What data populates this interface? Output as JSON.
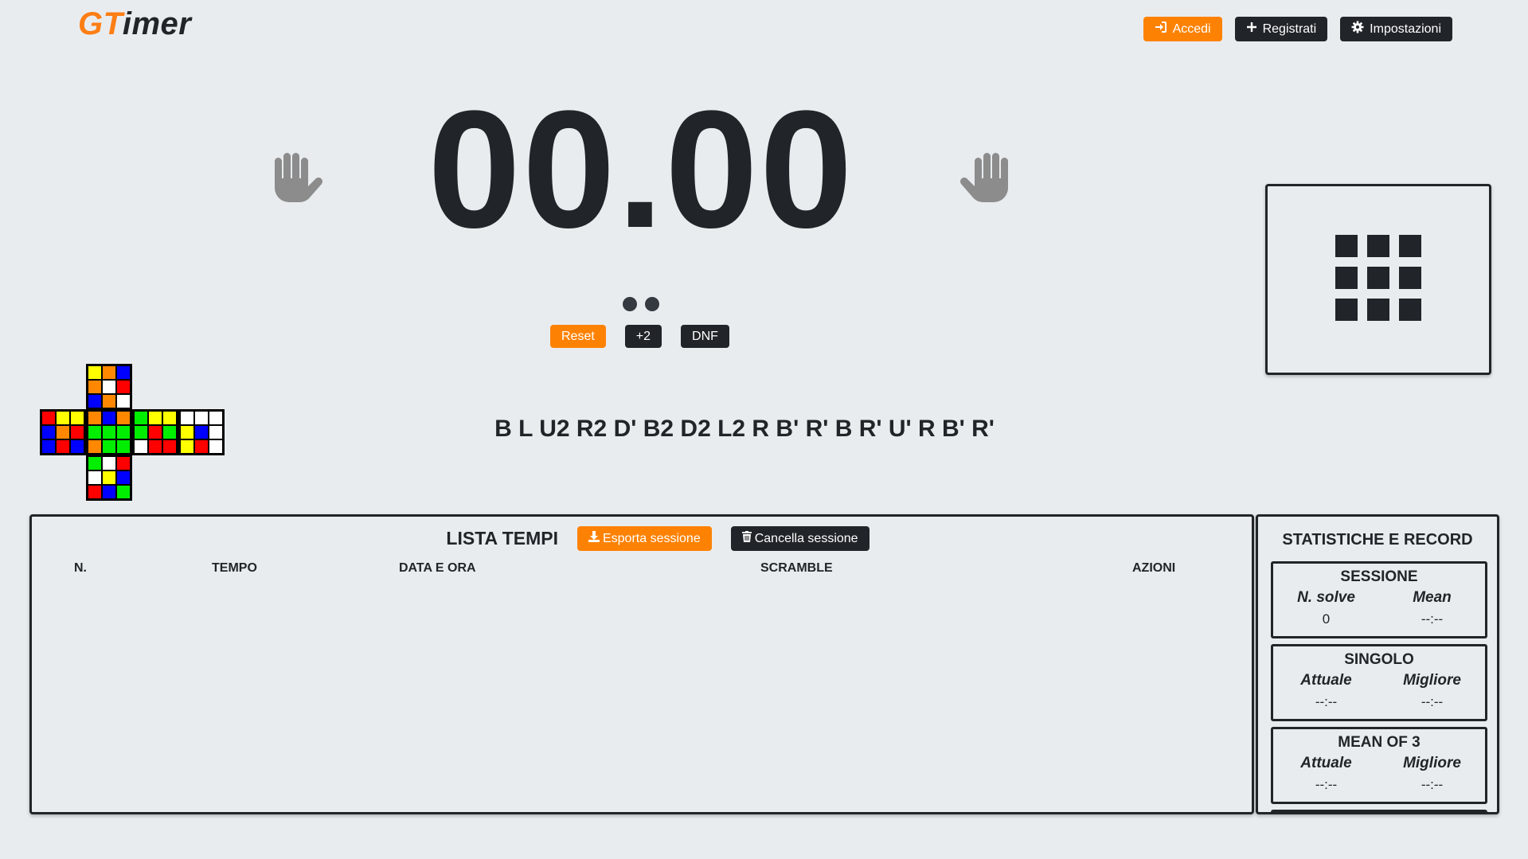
{
  "logo": {
    "part1": "GT",
    "part2": "imer"
  },
  "nav": {
    "login": "Accedi",
    "register": "Registrati",
    "settings": "Impostazioni"
  },
  "timer": {
    "display": "00.00"
  },
  "actions": {
    "reset": "Reset",
    "plus2": "+2",
    "dnf": "DNF"
  },
  "scramble": "B L U2 R2 D' B2 D2 L2 R B' R' B R' U' R B' R'",
  "cube": {
    "colors": {
      "Y": "#ffff00",
      "O": "#ff8800",
      "B": "#0000ff",
      "W": "#ffffff",
      "R": "#ff0000",
      "G": "#00ee00"
    },
    "up": [
      "Y",
      "O",
      "B",
      "O",
      "W",
      "R",
      "B",
      "O",
      "W"
    ],
    "left": [
      "R",
      "Y",
      "Y",
      "B",
      "O",
      "R",
      "B",
      "R",
      "B"
    ],
    "front": [
      "O",
      "B",
      "O",
      "G",
      "G",
      "G",
      "O",
      "G",
      "G"
    ],
    "right": [
      "G",
      "Y",
      "Y",
      "G",
      "R",
      "G",
      "W",
      "R",
      "R"
    ],
    "back": [
      "W",
      "W",
      "W",
      "Y",
      "B",
      "W",
      "Y",
      "R",
      "W"
    ],
    "down": [
      "G",
      "W",
      "R",
      "W",
      "Y",
      "B",
      "R",
      "B",
      "G"
    ]
  },
  "times": {
    "title": "LISTA TEMPI",
    "export_label": "Esporta sessione",
    "clear_label": "Cancella sessione",
    "columns": [
      "N.",
      "TEMPO",
      "DATA E ORA",
      "SCRAMBLE",
      "AZIONI"
    ],
    "rows": []
  },
  "stats": {
    "title": "STATISTICHE E RECORD",
    "session": {
      "title": "SESSIONE",
      "col1": "N. solve",
      "col2": "Mean",
      "val1": "0",
      "val2": "--:--"
    },
    "single": {
      "title": "SINGOLO",
      "col1": "Attuale",
      "col2": "Migliore",
      "val1": "--:--",
      "val2": "--:--"
    },
    "mo3": {
      "title": "MEAN OF 3",
      "col1": "Attuale",
      "col2": "Migliore",
      "val1": "--:--",
      "val2": "--:--"
    }
  }
}
